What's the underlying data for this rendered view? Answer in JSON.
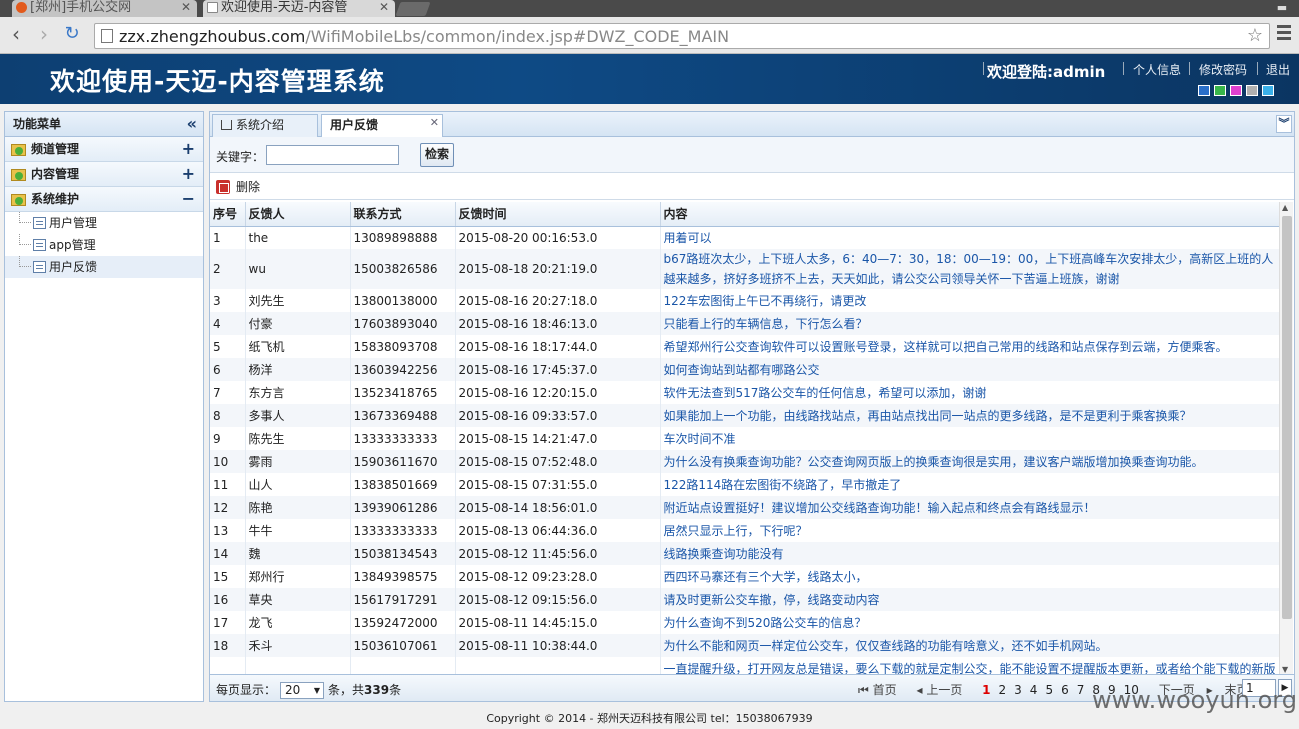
{
  "browser": {
    "tabs": [
      {
        "title": "[郑州]手机公交网",
        "active": false
      },
      {
        "title": "欢迎使用-天迈-内容管",
        "active": true
      }
    ],
    "url_host": "zzx.zhengzhoubus.com",
    "url_path": "/WifiMobileLbs/common/index.jsp#DWZ_CODE_MAIN"
  },
  "header": {
    "title": "欢迎使用-天迈-内容管理系统",
    "welcome": "欢迎登陆:admin",
    "links": [
      "个人信息",
      "修改密码",
      "退出"
    ],
    "theme_colors": [
      "#2a6fc9",
      "#39b54a",
      "#e040d0",
      "#b0b0b0",
      "#3ab0e8"
    ]
  },
  "sidebar": {
    "title": "功能菜单",
    "sections": [
      {
        "label": "频道管理",
        "toggle": "+"
      },
      {
        "label": "内容管理",
        "toggle": "+"
      },
      {
        "label": "系统维护",
        "toggle": "−"
      }
    ],
    "items": [
      "用户管理",
      "app管理",
      "用户反馈"
    ]
  },
  "panel": {
    "tabs": [
      "系统介绍",
      "用户反馈"
    ],
    "keyword_label": "关键字：",
    "search_button": "检索",
    "delete_label": "删除"
  },
  "table": {
    "columns": [
      "序号",
      "反馈人",
      "联系方式",
      "反馈时间",
      "内容"
    ],
    "rows": [
      [
        "1",
        "the",
        "13089898888",
        "2015-08-20 00:16:53.0",
        "用着可以"
      ],
      [
        "2",
        "wu",
        "15003826586",
        "2015-08-18 20:21:19.0",
        "b67路班次太少，上下班人太多，6：40—7：30，18：00—19：00，上下班高峰车次安排太少，高新区上班的人越来越多，挤好多班挤不上去，天天如此，请公交公司领导关怀一下苦逼上班族，谢谢"
      ],
      [
        "3",
        "刘先生",
        "13800138000",
        "2015-08-16 20:27:18.0",
        "122车宏图街上午已不再绕行，请更改"
      ],
      [
        "4",
        "付豪",
        "17603893040",
        "2015-08-16 18:46:13.0",
        "只能看上行的车辆信息，下行怎么看？"
      ],
      [
        "5",
        "纸飞机",
        "15838093708",
        "2015-08-16 18:17:44.0",
        "希望郑州行公交查询软件可以设置账号登录，这样就可以把自己常用的线路和站点保存到云端，方便乘客。"
      ],
      [
        "6",
        "杨洋",
        "13603942256",
        "2015-08-16 17:45:37.0",
        "如何查询站到站都有哪路公交"
      ],
      [
        "7",
        "东方言",
        "13523418765",
        "2015-08-16 12:20:15.0",
        "软件无法查到517路公交车的任何信息，希望可以添加，谢谢"
      ],
      [
        "8",
        "多事人",
        "13673369488",
        "2015-08-16 09:33:57.0",
        "如果能加上一个功能，由线路找站点，再由站点找出同一站点的更多线路，是不是更利于乘客换乘？"
      ],
      [
        "9",
        "陈先生",
        "13333333333",
        "2015-08-15 14:21:47.0",
        "车次时间不准"
      ],
      [
        "10",
        "雾雨",
        "15903611670",
        "2015-08-15 07:52:48.0",
        "为什么没有换乘查询功能？公交查询网页版上的换乘查询很是实用，建议客户端版增加换乘查询功能。"
      ],
      [
        "11",
        "山人",
        "13838501669",
        "2015-08-15 07:31:55.0",
        "122路114路在宏图街不绕路了，早市撤走了"
      ],
      [
        "12",
        "陈艳",
        "13939061286",
        "2015-08-14 18:56:01.0",
        "附近站点设置挺好！建议增加公交线路查询功能！输入起点和终点会有路线显示！"
      ],
      [
        "13",
        "牛牛",
        "13333333333",
        "2015-08-13 06:44:36.0",
        "居然只显示上行，下行呢？"
      ],
      [
        "14",
        "魏",
        "15038134543",
        "2015-08-12 11:45:56.0",
        "线路换乘查询功能没有"
      ],
      [
        "15",
        "郑州行",
        "13849398575",
        "2015-08-12 09:23:28.0",
        "西四环马寨还有三个大学，线路太小，"
      ],
      [
        "16",
        "草央",
        "15617917291",
        "2015-08-12 09:15:56.0",
        "请及时更新公交车撤，停，线路变动内容"
      ],
      [
        "17",
        "龙飞",
        "13592472000",
        "2015-08-11 14:45:15.0",
        "为什么查询不到520路公交车的信息？"
      ],
      [
        "18",
        "禾斗",
        "15036107061",
        "2015-08-11 10:38:44.0",
        "为什么不能和网页一样定位公交车，仅仅查线路的功能有啥意义，还不如手机网站。"
      ],
      [
        "",
        "",
        "",
        "",
        "一直提醒升级，打开网友总是错误，要么下载的就是定制公交，能不能设置不提醒版本更新，或者给个能下载的新版"
      ]
    ]
  },
  "pager": {
    "per_page_label": "每页显示：",
    "per_page_value": "20",
    "total_prefix": "条，共",
    "total": "339",
    "total_suffix": "条",
    "first": "首页",
    "prev": "上一页",
    "pages": [
      "1",
      "2",
      "3",
      "4",
      "5",
      "6",
      "7",
      "8",
      "9",
      "10"
    ],
    "current_page": "1",
    "next": "下一页",
    "last": "末页",
    "jump_value": "1"
  },
  "footer": "Copyright © 2014 - 郑州天迈科技有限公司 tel：15038067939",
  "watermark": "www.wooyun.org"
}
